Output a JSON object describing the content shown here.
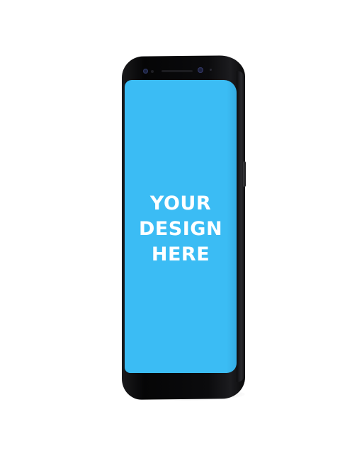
{
  "mockup": {
    "screen_text_lines": [
      "YOUR",
      "DESIGN",
      "HERE"
    ],
    "screen_color": "#3bbcf4",
    "phone_color": "#0a0a0b",
    "background_color": "#ffffff"
  }
}
